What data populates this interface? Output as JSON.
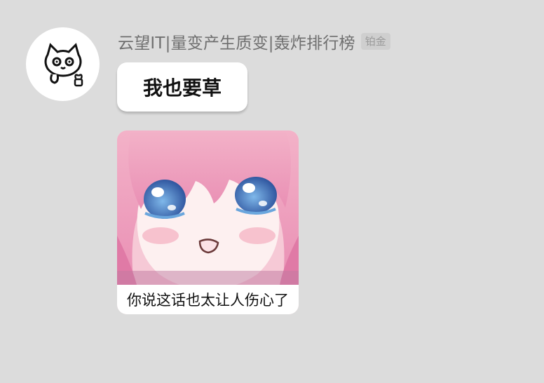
{
  "message": {
    "sender_name": "云望IT|量变产生质变|轰炸排行榜",
    "rank_badge": "铂金",
    "text": "我也要草",
    "sticker_caption": "你说这话也太让人伤心了"
  },
  "icons": {
    "avatar": "cat-avatar-icon"
  },
  "colors": {
    "background": "#dcdcdc",
    "bubble": "#ffffff",
    "sender_name": "#6f6f6f",
    "sticker_hair": "#f0a0c0"
  }
}
